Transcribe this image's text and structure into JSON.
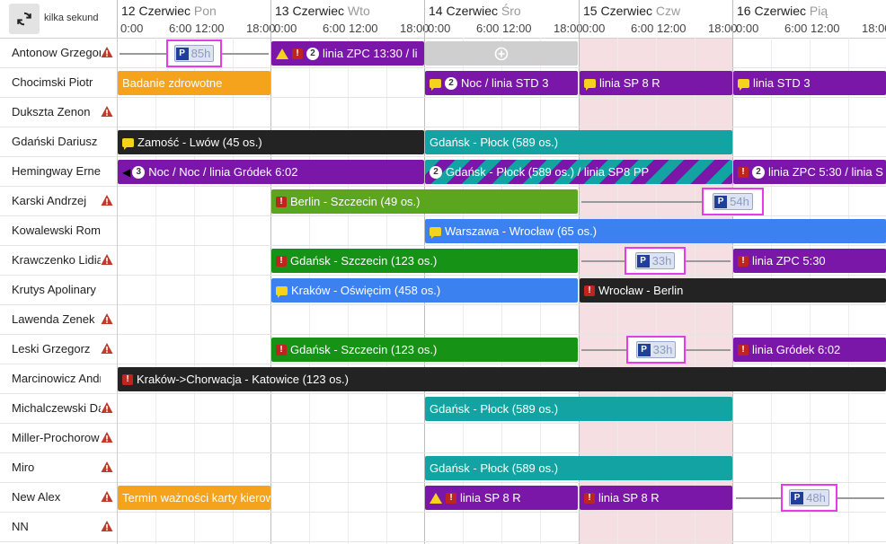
{
  "header": {
    "refresh_label": "kilka sekund",
    "days": [
      {
        "date": "12 Czerwiec",
        "dow": "Pon",
        "hours": [
          "0:00",
          "6:00",
          "12:00",
          "18:00"
        ]
      },
      {
        "date": "13 Czerwiec",
        "dow": "Wto",
        "hours": [
          "0:00",
          "6:00",
          "12:00",
          "18:00"
        ]
      },
      {
        "date": "14 Czerwiec",
        "dow": "Śro",
        "hours": [
          "0:00",
          "6:00",
          "12:00",
          "18:00"
        ]
      },
      {
        "date": "15 Czerwiec",
        "dow": "Czw",
        "hours": [
          "0:00",
          "6:00",
          "12:00",
          "18:00"
        ]
      },
      {
        "date": "16 Czerwiec",
        "dow": "Pią",
        "hours": [
          "0:00",
          "6:00",
          "12:00",
          "18:00"
        ]
      }
    ]
  },
  "colors": {
    "orange": "#f5a21c",
    "purple": "#7b17a8",
    "teal": "#13a3a3",
    "black": "#232323",
    "green": "#169316",
    "light_green": "#5ba51f",
    "blue": "#3b82f0",
    "holiday": "#f6dfe3",
    "highlight": "#e83be8",
    "warning": "#c0392b"
  },
  "drivers": [
    {
      "name": "Antonow Grzegorz",
      "warning": true
    },
    {
      "name": "Chocimski Piotr",
      "warning": false
    },
    {
      "name": "Dukszta Zenon",
      "warning": true
    },
    {
      "name": "Gdański Dariusz",
      "warning": false
    },
    {
      "name": "Hemingway Ernest",
      "warning": false
    },
    {
      "name": "Karski Andrzej",
      "warning": true
    },
    {
      "name": "Kowalewski Roman",
      "warning": false
    },
    {
      "name": "Krawczenko Lidia",
      "warning": true
    },
    {
      "name": "Krutys Apolinary",
      "warning": false
    },
    {
      "name": "Lawenda Zenek",
      "warning": true
    },
    {
      "name": "Leski Grzegorz",
      "warning": true
    },
    {
      "name": "Marcinowicz Andrzej",
      "warning": false
    },
    {
      "name": "Michalczewski Dariusz",
      "warning": true
    },
    {
      "name": "Miller-Prochorow Maciej",
      "warning": true
    },
    {
      "name": "Miro",
      "warning": true
    },
    {
      "name": "New Alex",
      "warning": true
    },
    {
      "name": "NN",
      "warning": true
    }
  ],
  "bars": {
    "r0_b1": {
      "label": "linia ZPC 13:30 / li",
      "badge": "2"
    },
    "r1_b0": {
      "label": "Badanie zdrowotne"
    },
    "r1_b1": {
      "label": "Noc / linia STD 3",
      "badge": "2"
    },
    "r1_b2": {
      "label": "linia SP 8 R"
    },
    "r1_b3": {
      "label": "linia STD 3"
    },
    "r3_b0": {
      "label": "Zamość - Lwów (45 os.)"
    },
    "r3_b1": {
      "label": "Gdańsk - Płock (589 os.)"
    },
    "r4_b0": {
      "label": "Noc / Noc / linia Gródek 6:02",
      "badge": "3"
    },
    "r4_b1": {
      "label": "Gdańsk - Płock (589 os.) / linia SP8 PP",
      "badge": "2"
    },
    "r4_b2": {
      "label": "linia ZPC 5:30 / linia S",
      "badge": "2"
    },
    "r5_b0": {
      "label": "Berlin - Szczecin (49 os.)"
    },
    "r6_b0": {
      "label": "Warszawa - Wrocław (65 os.)"
    },
    "r7_b0": {
      "label": "Gdańsk - Szczecin (123 os.)"
    },
    "r7_b1": {
      "label": "linia ZPC 5:30"
    },
    "r8_b0": {
      "label": "Kraków - Oświęcim (458 os.)"
    },
    "r8_b1": {
      "label": "Wrocław - Berlin"
    },
    "r10_b0": {
      "label": "Gdańsk - Szczecin (123 os.)"
    },
    "r10_b1": {
      "label": "linia Gródek 6:02"
    },
    "r11_b0": {
      "label": "Kraków->Chorwacja - Katowice (123 os.)"
    },
    "r12_b0": {
      "label": "Gdańsk - Płock (589 os.)"
    },
    "r14_b0": {
      "label": "Gdańsk - Płock (589 os.)"
    },
    "r15_b0": {
      "label": "Termin ważności karty kierowcy"
    },
    "r15_b1": {
      "label": "linia SP 8 R"
    },
    "r15_b2": {
      "label": "linia SP 8 R"
    }
  },
  "parkings": {
    "r0": {
      "letter": "P",
      "hours": "85h"
    },
    "r5": {
      "letter": "P",
      "hours": "54h"
    },
    "r7": {
      "letter": "P",
      "hours": "33h"
    },
    "r10": {
      "letter": "P",
      "hours": "33h"
    },
    "r15": {
      "letter": "P",
      "hours": "48h"
    }
  },
  "add_slot_icon": "plus-circle-icon"
}
